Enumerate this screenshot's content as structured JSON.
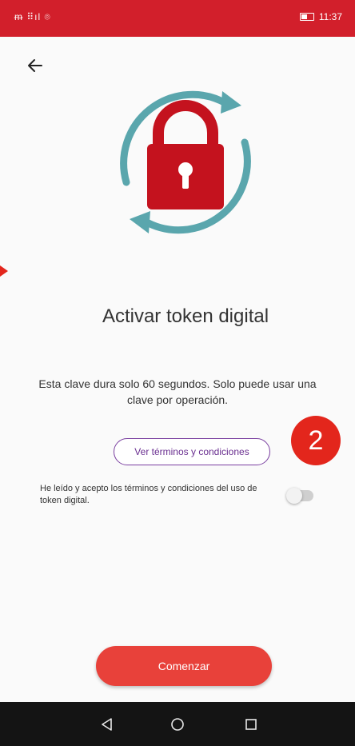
{
  "status_bar": {
    "left_text": "ᵯ ⠿ıl ⌾",
    "time": "11:37",
    "color": "#d21f2b"
  },
  "header": {
    "back_icon": "arrow-left-icon"
  },
  "hero": {
    "icon": "padlock-refresh-icon",
    "lock_color": "#c4121e",
    "arrows_color": "#5aa6ad"
  },
  "main": {
    "title": "Activar token digital",
    "description": "Esta clave dura solo 60 segundos. Solo puede usar una clave por operación.",
    "terms_button": "Ver términos y condiciones",
    "step_badge": "2",
    "consent_text": "He leído y acepto los términos y condiciones del uso de token digital.",
    "consent_toggle": "off",
    "start_button": "Comenzar"
  },
  "colors": {
    "accent": "#e8413a",
    "purple": "#7a3fa0",
    "badge": "#e3261c"
  },
  "nav_bar": {
    "back": "triangle-back-icon",
    "home": "circle-home-icon",
    "recents": "square-recents-icon"
  }
}
